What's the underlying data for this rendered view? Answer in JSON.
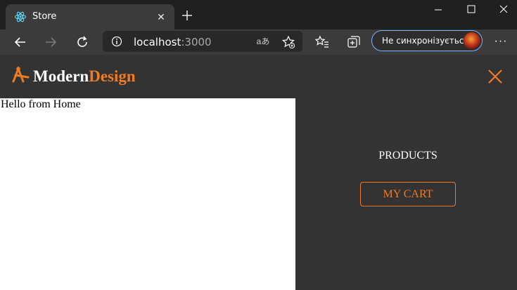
{
  "browser": {
    "tab_title": "Store",
    "tab_close_glyph": "✕",
    "address": {
      "host": "localhost",
      "port": ":3000"
    },
    "read_aloud_glyph": "aあ",
    "sync_label": "Не синхронізується",
    "menu_glyph": "···"
  },
  "header": {
    "brand_part1": "Modern",
    "brand_part2": "Design",
    "accent_color": "#f07b22"
  },
  "main": {
    "message": "Hello from Home"
  },
  "menu": {
    "products_label": "PRODUCTS",
    "cart_label": "MY CART"
  },
  "icons": [
    "react-favicon-icon",
    "plus-icon",
    "minimize-icon",
    "maximize-icon",
    "window-close-icon",
    "back-arrow-icon",
    "forward-arrow-icon",
    "refresh-icon",
    "info-icon",
    "read-aloud-icon",
    "add-favorite-icon",
    "favorites-icon",
    "collections-icon",
    "logo-icon",
    "close-menu-icon"
  ]
}
